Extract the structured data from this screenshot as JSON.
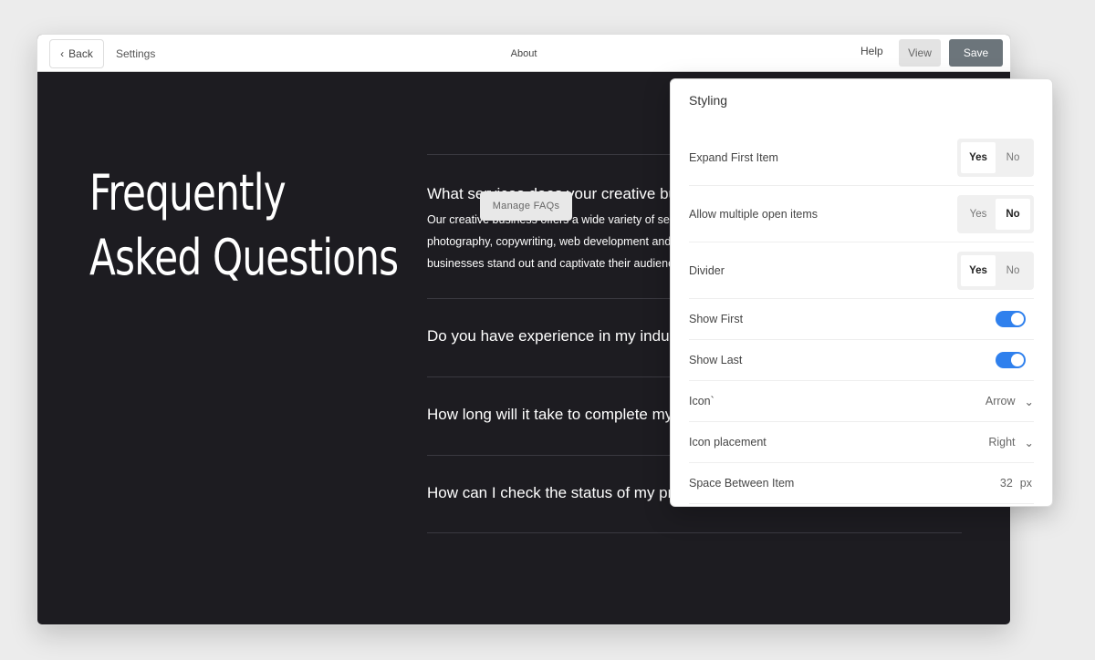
{
  "header": {
    "back": "Back",
    "settings": "Settings",
    "page": "About",
    "help": "Help",
    "view": "View",
    "save": "Save"
  },
  "hero": {
    "line1": "Frequently",
    "line2": "Asked Questions"
  },
  "faqs": [
    {
      "q": "What services does your creative bu",
      "a": [
        "Our creative business offers a wide variety of serv",
        "photography, copywriting, web development and",
        "businesses stand out and captivate their audienc"
      ]
    },
    {
      "q": "Do you have experience in my indus"
    },
    {
      "q": "How long will it take to complete my"
    },
    {
      "q": "How can I check the status of my pro"
    }
  ],
  "manage_faqs": "Manage FAQs",
  "panel": {
    "title": "Styling",
    "expand_first": {
      "label": "Expand First Item",
      "yes": "Yes",
      "no": "No",
      "value": "Yes"
    },
    "allow_multiple": {
      "label": "Allow multiple open items",
      "yes": "Yes",
      "no": "No",
      "value": "No"
    },
    "divider": {
      "label": "Divider",
      "yes": "Yes",
      "no": "No",
      "value": "Yes"
    },
    "show_first": {
      "label": "Show First",
      "on": true
    },
    "show_last": {
      "label": "Show Last",
      "on": true
    },
    "icon": {
      "label": "Icon`",
      "value": "Arrow"
    },
    "icon_placement": {
      "label": "Icon placement",
      "value": "Right"
    },
    "space": {
      "label": "Space Between Item",
      "value": "32",
      "unit": "px"
    }
  },
  "colors": {
    "accent": "#2f80ed",
    "save": "#6c757b",
    "canvas": "#1d1c21"
  }
}
